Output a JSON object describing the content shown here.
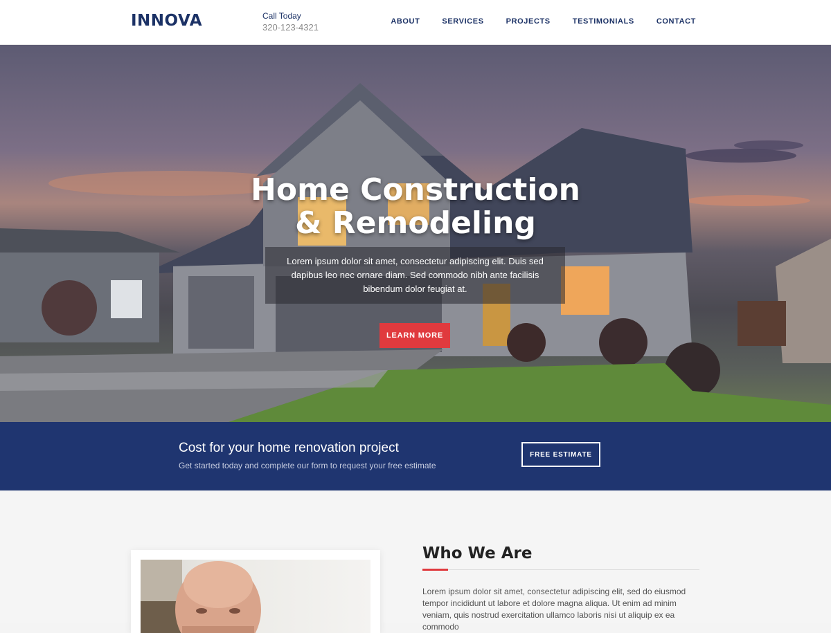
{
  "header": {
    "logo": "INNOVA",
    "call_label": "Call Today",
    "phone": "320-123-4321",
    "nav": [
      "ABOUT",
      "SERVICES",
      "PROJECTS",
      "TESTIMONIALS",
      "CONTACT"
    ]
  },
  "hero": {
    "title_line1": "Home Construction",
    "title_line2": "& Remodeling",
    "description": "Lorem ipsum dolor sit amet, consectetur adipiscing elit. Duis sed dapibus leo nec ornare diam. Sed commodo nibh ante facilisis bibendum dolor feugiat at.",
    "button": "LEARN MORE"
  },
  "cta": {
    "title": "Cost for your home renovation project",
    "subtitle": "Get started today and complete our form to request your free estimate",
    "button": "FREE ESTIMATE"
  },
  "about": {
    "title": "Who We Are",
    "text": "Lorem ipsum dolor sit amet, consectetur adipiscing elit, sed do eiusmod tempor incididunt ut labore et dolore magna aliqua. Ut enim ad minim veniam, quis nostrud exercitation ullamco laboris nisi ut aliquip ex ea commodo"
  },
  "colors": {
    "brand_navy": "#1c3266",
    "cta_band": "#1f3570",
    "accent_red": "#e03a3e"
  }
}
